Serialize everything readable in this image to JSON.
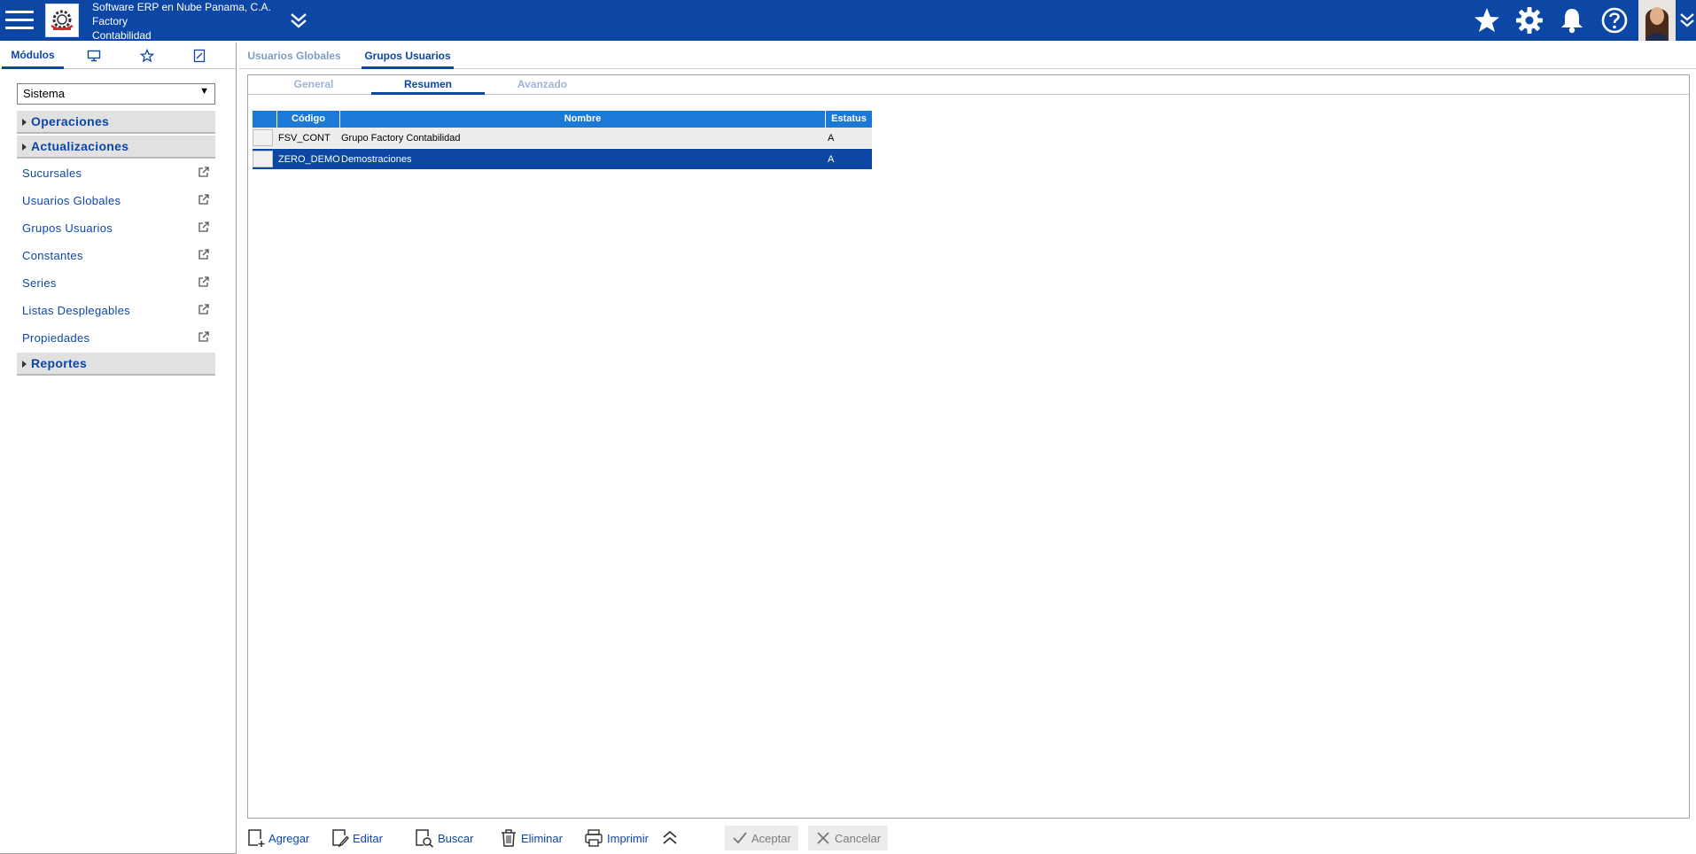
{
  "header": {
    "company_line1": "Software ERP en Nube Panama, C.A.",
    "company_line2": "Factory",
    "company_line3": "Contabilidad"
  },
  "left": {
    "tabs": [
      {
        "label": "Módulos",
        "icon": "modules"
      },
      {
        "label": "",
        "icon": "monitor-icon"
      },
      {
        "label": "",
        "icon": "star-icon"
      },
      {
        "label": "",
        "icon": "notes-icon"
      }
    ],
    "module_select": "Sistema",
    "sections": {
      "operaciones": "Operaciones",
      "actualizaciones": "Actualizaciones",
      "reportes": "Reportes"
    },
    "items": [
      {
        "label": "Sucursales"
      },
      {
        "label": "Usuarios Globales"
      },
      {
        "label": "Grupos Usuarios"
      },
      {
        "label": "Constantes"
      },
      {
        "label": "Series"
      },
      {
        "label": "Listas Desplegables"
      },
      {
        "label": "Propiedades"
      }
    ]
  },
  "main": {
    "tabs": [
      {
        "label": "Usuarios Globales",
        "active": false
      },
      {
        "label": "Grupos Usuarios",
        "active": true
      }
    ],
    "subtabs": [
      {
        "label": "General",
        "active": false
      },
      {
        "label": "Resumen",
        "active": true
      },
      {
        "label": "Avanzado",
        "active": false
      }
    ],
    "grid": {
      "headers": {
        "codigo": "Código",
        "nombre": "Nombre",
        "estatus": "Estatus"
      },
      "rows": [
        {
          "codigo": "FSV_CONT",
          "nombre": "Grupo Factory Contabilidad",
          "estatus": "A",
          "selected": false
        },
        {
          "codigo": "ZERO_DEMO",
          "nombre": "Demostraciones",
          "estatus": "A",
          "selected": true
        }
      ]
    }
  },
  "toolbar": {
    "agregar": "Agregar",
    "editar": "Editar",
    "buscar": "Buscar",
    "eliminar": "Eliminar",
    "imprimir": "Imprimir",
    "aceptar": "Aceptar",
    "cancelar": "Cancelar"
  },
  "colors": {
    "brand": "#0c47a6",
    "grid_header": "#1c7ad6",
    "row_selected": "#0c47a6"
  }
}
